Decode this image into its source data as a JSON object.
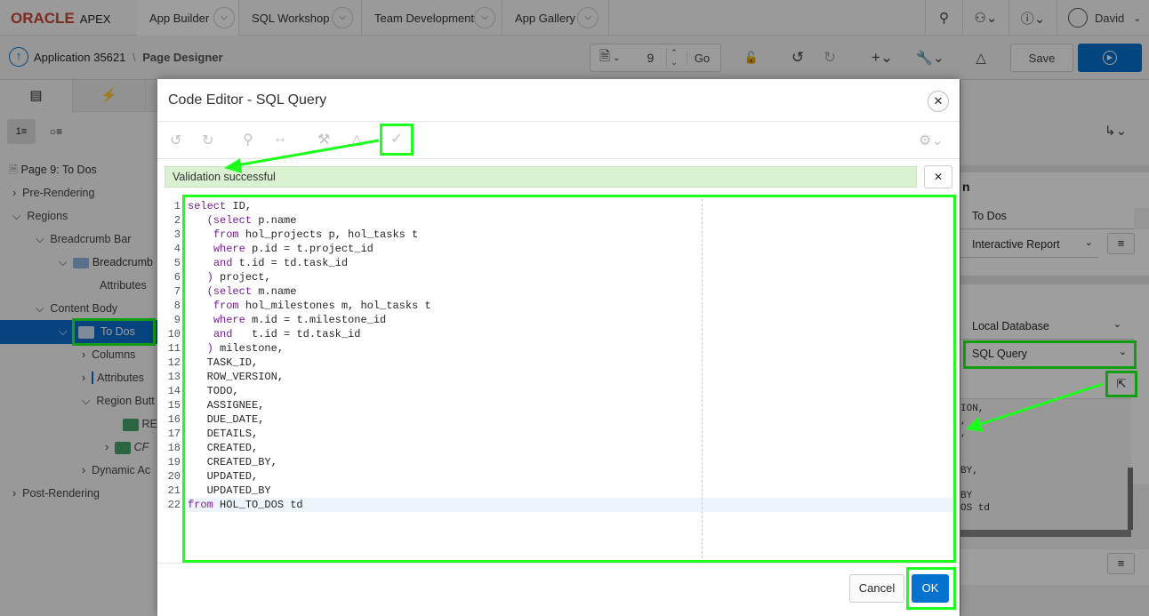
{
  "topnav": {
    "logo": "ORACLE",
    "apex": "APEX",
    "tabs": [
      "App Builder",
      "SQL Workshop",
      "Team Development",
      "App Gallery"
    ],
    "user": "David"
  },
  "bar2": {
    "app_label": "Application 35621",
    "sep": "\\",
    "page_designer": "Page Designer",
    "page_number": "9",
    "go": "Go",
    "save": "Save"
  },
  "tree": {
    "page_title": "Page 9: To Dos",
    "items": [
      "Pre-Rendering",
      "Regions",
      "Breadcrumb Bar",
      "Breadcrumb",
      "Attributes",
      "Content Body",
      "To Dos",
      "Columns",
      "Attributes",
      "Region Butt",
      "RE",
      "CF",
      "Dynamic Ac",
      "Post-Rendering"
    ]
  },
  "right": {
    "title_frag": "n",
    "name_value": "To Dos",
    "type_value": "Interactive Report",
    "location_value": "Local Database",
    "source_type_value": "SQL Query",
    "code_preview": [
      "ION,",
      ",",
      ",",
      "",
      "",
      "BY,",
      "",
      "BY",
      "OS td"
    ]
  },
  "dialog": {
    "title": "Code Editor - SQL Query",
    "validation": "Validation successful",
    "cancel": "Cancel",
    "ok": "OK",
    "code_lines": [
      [
        [
          "k",
          "select"
        ],
        [
          "t",
          " ID,"
        ]
      ],
      [
        [
          "t",
          "   "
        ],
        [
          "k",
          "(select"
        ],
        [
          "t",
          " p.name"
        ]
      ],
      [
        [
          "t",
          "    "
        ],
        [
          "k",
          "from"
        ],
        [
          "t",
          " hol_projects p, hol_tasks t"
        ]
      ],
      [
        [
          "t",
          "    "
        ],
        [
          "k",
          "where"
        ],
        [
          "t",
          " p.id = t.project_id"
        ]
      ],
      [
        [
          "t",
          "    "
        ],
        [
          "k",
          "and"
        ],
        [
          "t",
          " t.id = td.task_id"
        ]
      ],
      [
        [
          "t",
          "   "
        ],
        [
          "k",
          ")"
        ],
        [
          "t",
          " project,"
        ]
      ],
      [
        [
          "t",
          "   "
        ],
        [
          "k",
          "(select"
        ],
        [
          "t",
          " m.name"
        ]
      ],
      [
        [
          "t",
          "    "
        ],
        [
          "k",
          "from"
        ],
        [
          "t",
          " hol_milestones m, hol_tasks t"
        ]
      ],
      [
        [
          "t",
          "    "
        ],
        [
          "k",
          "where"
        ],
        [
          "t",
          " m.id = t.milestone_id"
        ]
      ],
      [
        [
          "t",
          "    "
        ],
        [
          "k",
          "and"
        ],
        [
          "t",
          "   t.id = td.task_id"
        ]
      ],
      [
        [
          "t",
          "   "
        ],
        [
          "k",
          ")"
        ],
        [
          "t",
          " milestone,"
        ]
      ],
      [
        [
          "t",
          "   TASK_ID,"
        ]
      ],
      [
        [
          "t",
          "   ROW_VERSION,"
        ]
      ],
      [
        [
          "t",
          "   TODO,"
        ]
      ],
      [
        [
          "t",
          "   ASSIGNEE,"
        ]
      ],
      [
        [
          "t",
          "   DUE_DATE,"
        ]
      ],
      [
        [
          "t",
          "   DETAILS,"
        ]
      ],
      [
        [
          "t",
          "   CREATED,"
        ]
      ],
      [
        [
          "t",
          "   CREATED_BY,"
        ]
      ],
      [
        [
          "t",
          "   UPDATED,"
        ]
      ],
      [
        [
          "t",
          "   UPDATED_BY"
        ]
      ],
      [
        [
          "k",
          "from"
        ],
        [
          "t",
          " HOL_TO_DOS td"
        ]
      ]
    ]
  },
  "colors": {
    "brand": "#c74634",
    "accent": "#0572ce",
    "highlight": "#1dff1d",
    "selected": "#0c6ccc"
  }
}
